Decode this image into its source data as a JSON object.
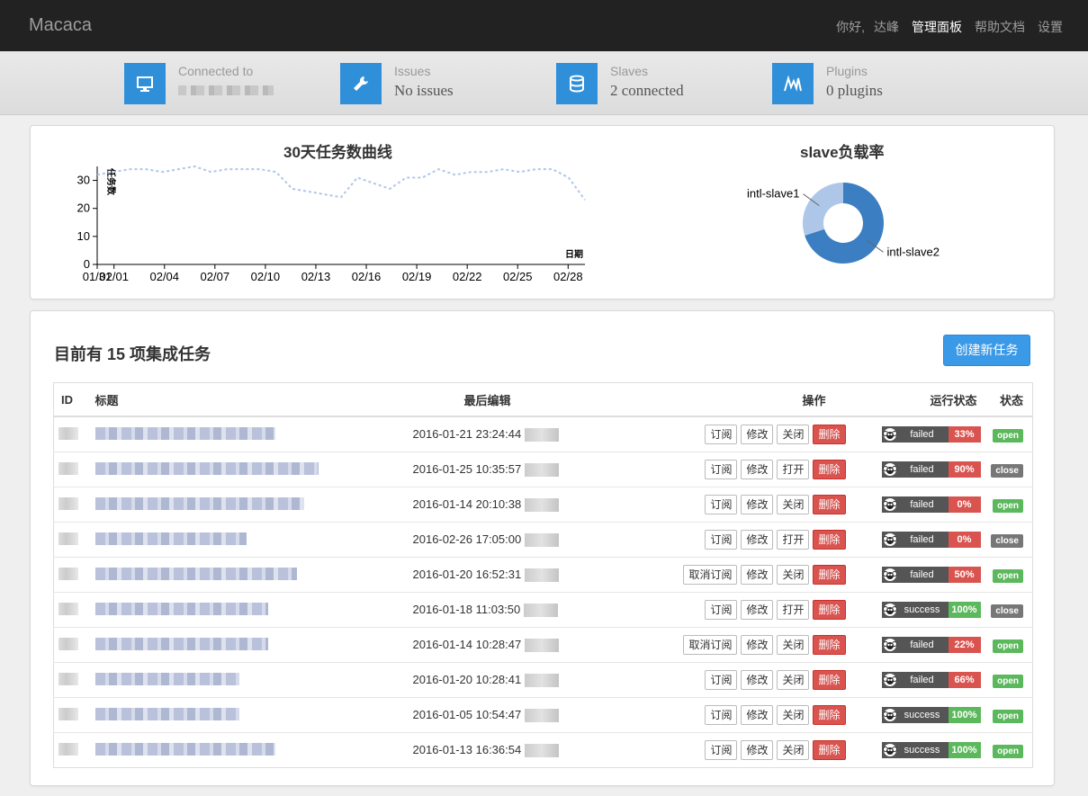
{
  "navbar": {
    "brand": "Macaca",
    "greeting": "你好,",
    "user": "达峰",
    "links": [
      "管理面板",
      "帮助文档",
      "设置"
    ]
  },
  "stats": [
    {
      "label": "Connected to",
      "value": "",
      "icon": "monitor-icon"
    },
    {
      "label": "Issues",
      "value": "No issues",
      "icon": "wrench-icon"
    },
    {
      "label": "Slaves",
      "value": "2 connected",
      "icon": "database-icon"
    },
    {
      "label": "Plugins",
      "value": "0 plugins",
      "icon": "plugin-icon"
    }
  ],
  "colors": {
    "accent": "#2f8fd8",
    "danger": "#d9534f",
    "success": "#5cb85c",
    "closed": "#777777"
  },
  "chart_data": [
    {
      "type": "line",
      "title": "30天任务数曲线",
      "ylabel": "任务数",
      "xlabel": "日期",
      "ylim": [
        0,
        35
      ],
      "yticks": [
        0,
        10,
        20,
        30
      ],
      "xticks": [
        "01/31",
        "02/01",
        "02/04",
        "02/07",
        "02/10",
        "02/13",
        "02/16",
        "02/19",
        "02/22",
        "02/25",
        "02/28"
      ],
      "x": [
        "01/31",
        "02/01",
        "02/02",
        "02/03",
        "02/04",
        "02/05",
        "02/06",
        "02/07",
        "02/08",
        "02/09",
        "02/10",
        "02/11",
        "02/12",
        "02/13",
        "02/14",
        "02/15",
        "02/16",
        "02/17",
        "02/18",
        "02/19",
        "02/20",
        "02/21",
        "02/22",
        "02/23",
        "02/24",
        "02/25",
        "02/26",
        "02/27",
        "02/28",
        "02/29"
      ],
      "series": [
        {
          "values": [
            32,
            33,
            34,
            34,
            33,
            34,
            35,
            33,
            34,
            34,
            34,
            33,
            27,
            26,
            25,
            24,
            31,
            29,
            27,
            31,
            31,
            34,
            32,
            33,
            33,
            34,
            33,
            34,
            34,
            31,
            23
          ]
        }
      ]
    },
    {
      "type": "pie",
      "title": "slave负载率",
      "labels": [
        "intl-slave1",
        "intl-slave2"
      ],
      "values": [
        30,
        70
      ],
      "colors": [
        "#aec7e8",
        "#3b7ec1"
      ]
    }
  ],
  "tasks": {
    "title": "目前有 15 项集成任务",
    "create_label": "创建新任务",
    "headers": [
      "ID",
      "标题",
      "最后编辑",
      "操作",
      "运行状态",
      "状态"
    ],
    "rows": [
      {
        "date": "2016-01-21 23:24:44",
        "sub": "订阅",
        "toggle": "关闭",
        "result": "failed",
        "rate": "33%",
        "status": "open"
      },
      {
        "date": "2016-01-25 10:35:57",
        "sub": "订阅",
        "toggle": "打开",
        "result": "failed",
        "rate": "90%",
        "status": "close"
      },
      {
        "date": "2016-01-14 20:10:38",
        "sub": "订阅",
        "toggle": "关闭",
        "result": "failed",
        "rate": "0%",
        "status": "open"
      },
      {
        "date": "2016-02-26 17:05:00",
        "sub": "订阅",
        "toggle": "打开",
        "result": "failed",
        "rate": "0%",
        "status": "close"
      },
      {
        "date": "2016-01-20 16:52:31",
        "sub": "取消订阅",
        "toggle": "关闭",
        "result": "failed",
        "rate": "50%",
        "status": "open"
      },
      {
        "date": "2016-01-18 11:03:50",
        "sub": "订阅",
        "toggle": "打开",
        "result": "success",
        "rate": "100%",
        "status": "close"
      },
      {
        "date": "2016-01-14 10:28:47",
        "sub": "取消订阅",
        "toggle": "关闭",
        "result": "failed",
        "rate": "22%",
        "status": "open"
      },
      {
        "date": "2016-01-20 10:28:41",
        "sub": "订阅",
        "toggle": "关闭",
        "result": "failed",
        "rate": "66%",
        "status": "open"
      },
      {
        "date": "2016-01-05 10:54:47",
        "sub": "订阅",
        "toggle": "关闭",
        "result": "success",
        "rate": "100%",
        "status": "open"
      },
      {
        "date": "2016-01-13 16:36:54",
        "sub": "订阅",
        "toggle": "关闭",
        "result": "success",
        "rate": "100%",
        "status": "open"
      }
    ],
    "edit_label": "修改",
    "delete_label": "删除"
  }
}
